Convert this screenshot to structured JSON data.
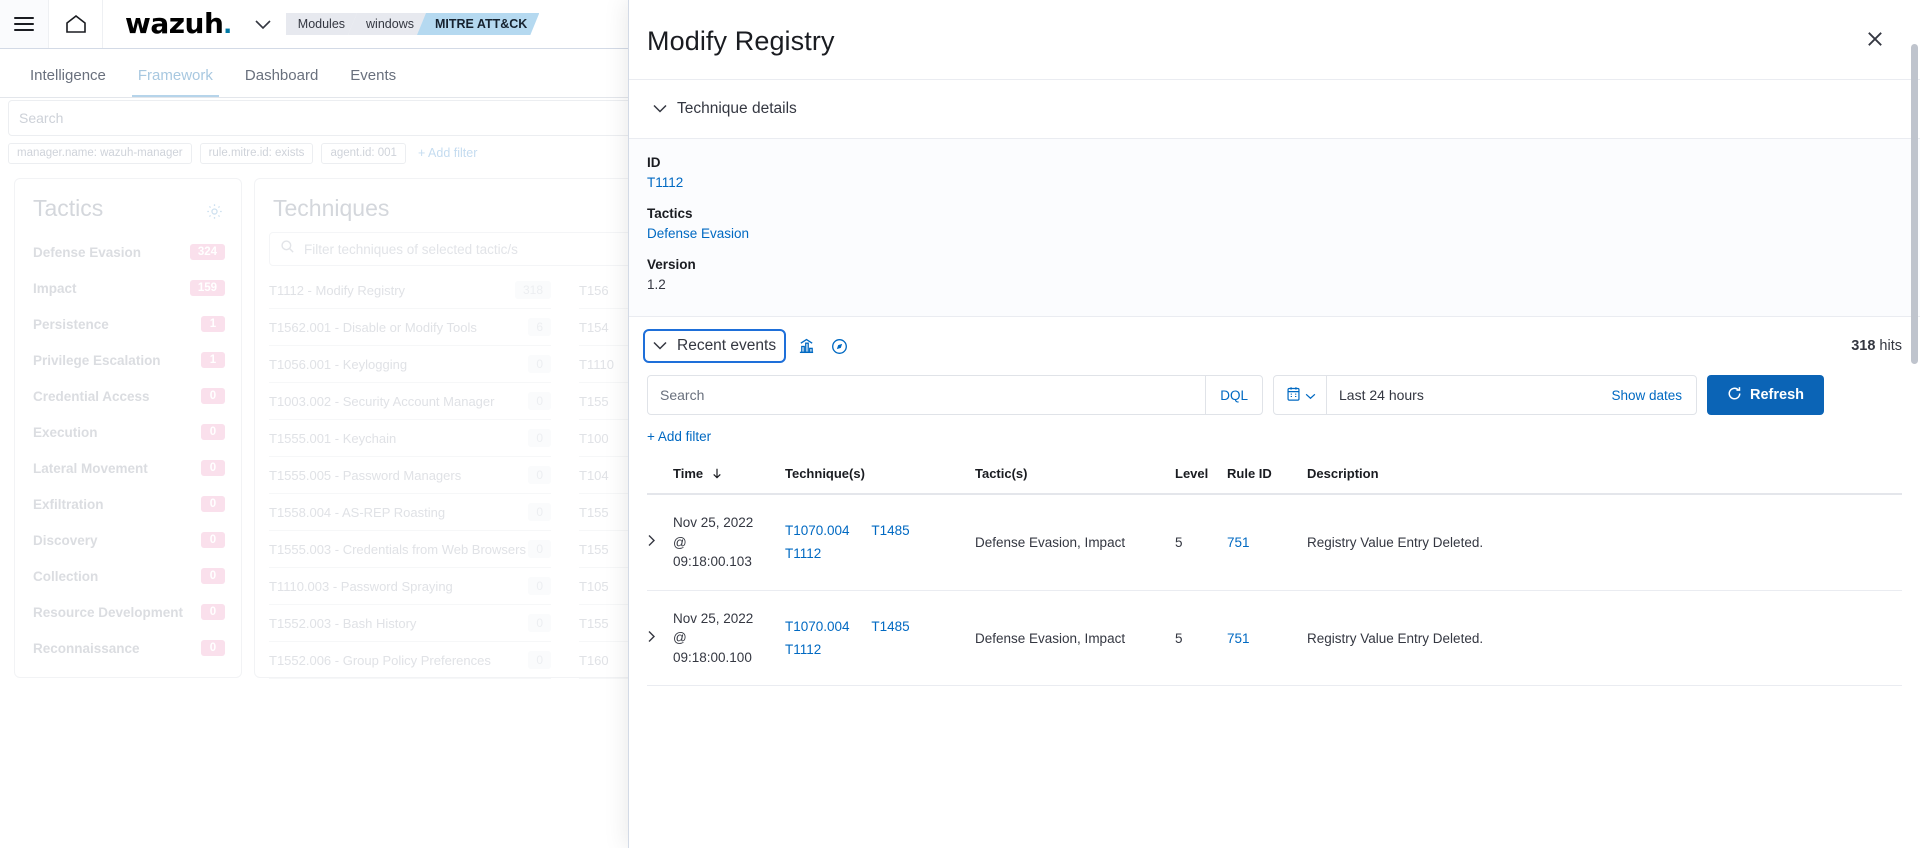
{
  "topbar": {
    "menu_icon": "hamburger-icon",
    "home_icon": "home-icon",
    "brand": "wazuh",
    "brand_dot": ".",
    "chevron_icon": "chevron-down-icon",
    "breadcrumbs": [
      {
        "label": "Modules",
        "active": false
      },
      {
        "label": "windows",
        "active": false
      },
      {
        "label": "MITRE ATT&CK",
        "active": true
      }
    ]
  },
  "tabs": [
    {
      "label": "Intelligence",
      "active": false
    },
    {
      "label": "Framework",
      "active": true
    },
    {
      "label": "Dashboard",
      "active": false
    },
    {
      "label": "Events",
      "active": false
    }
  ],
  "search": {
    "placeholder": "Search",
    "filters": [
      "manager.name: wazuh-manager",
      "rule.mitre.id: exists",
      "agent.id: 001"
    ],
    "add_filter": "+ Add filter"
  },
  "tactics_panel": {
    "title": "Tactics",
    "gear_icon": "gear-icon",
    "items": [
      {
        "label": "Defense Evasion",
        "count": "324"
      },
      {
        "label": "Impact",
        "count": "159"
      },
      {
        "label": "Persistence",
        "count": "1"
      },
      {
        "label": "Privilege Escalation",
        "count": "1"
      },
      {
        "label": "Credential Access",
        "count": "0"
      },
      {
        "label": "Execution",
        "count": "0"
      },
      {
        "label": "Lateral Movement",
        "count": "0"
      },
      {
        "label": "Exfiltration",
        "count": "0"
      },
      {
        "label": "Discovery",
        "count": "0"
      },
      {
        "label": "Collection",
        "count": "0"
      },
      {
        "label": "Resource Development",
        "count": "0"
      },
      {
        "label": "Reconnaissance",
        "count": "0"
      }
    ]
  },
  "techniques_panel": {
    "title": "Techniques",
    "filter_placeholder": "Filter techniques of selected tactic/s",
    "search_icon": "search-icon",
    "items": [
      {
        "label": "T1112 - Modify Registry",
        "count": "318"
      },
      {
        "label": "T1562.001 - Disable or Modify Tools",
        "count": "6"
      },
      {
        "label": "T1056.001 - Keylogging",
        "count": "0"
      },
      {
        "label": "T1003.002 - Security Account Manager",
        "count": "0"
      },
      {
        "label": "T1555.001 - Keychain",
        "count": "0"
      },
      {
        "label": "T1555.005 - Password Managers",
        "count": "0"
      },
      {
        "label": "T1558.004 - AS-REP Roasting",
        "count": "0"
      },
      {
        "label": "T1555.003 - Credentials from Web Browsers",
        "count": "0"
      },
      {
        "label": "T1110.003 - Password Spraying",
        "count": "0"
      },
      {
        "label": "T1552.003 - Bash History",
        "count": "0"
      },
      {
        "label": "T1552.006 - Group Policy Preferences",
        "count": "0"
      }
    ],
    "items_col2": [
      {
        "label": "T156",
        "count": ""
      },
      {
        "label": "T154",
        "count": ""
      },
      {
        "label": "T1110",
        "count": ""
      },
      {
        "label": "T155",
        "count": ""
      },
      {
        "label": "T100",
        "count": ""
      },
      {
        "label": "T104",
        "count": ""
      },
      {
        "label": "T155",
        "count": ""
      },
      {
        "label": "T155",
        "count": ""
      },
      {
        "label": "T105",
        "count": ""
      },
      {
        "label": "T155",
        "count": ""
      },
      {
        "label": "T160",
        "count": ""
      }
    ]
  },
  "flyout": {
    "title": "Modify Registry",
    "close_icon": "close-icon",
    "details_accordion": {
      "label": "Technique details",
      "chevron_icon": "chevron-down-icon",
      "fields": [
        {
          "label": "ID",
          "value": "T1112",
          "is_link": true
        },
        {
          "label": "Tactics",
          "value": "Defense Evasion",
          "is_link": true
        },
        {
          "label": "Version",
          "value": "1.2",
          "is_link": false
        }
      ]
    },
    "events_accordion": {
      "label": "Recent events",
      "chevron_icon": "chevron-down-icon",
      "focused": true,
      "visualize_icon": "bar-chart-icon",
      "discover_icon": "compass-icon",
      "hits_count": "318",
      "hits_label": "hits"
    },
    "query": {
      "search_placeholder": "Search",
      "search_value": "",
      "dql_label": "DQL",
      "calendar_icon": "calendar-icon",
      "chevron_icon": "chevron-down-icon",
      "time_range": "Last 24 hours",
      "show_dates": "Show dates",
      "refresh_icon": "refresh-icon",
      "refresh_label": "Refresh",
      "add_filter": "+ Add filter"
    },
    "table": {
      "columns": [
        "Time",
        "Technique(s)",
        "Tactic(s)",
        "Level",
        "Rule ID",
        "Description"
      ],
      "sort_icon": "arrow-down-icon",
      "expand_icon": "chevron-right-icon",
      "rows": [
        {
          "time_line1": "Nov 25, 2022",
          "time_line2": "@",
          "time_line3": "09:18:00.103",
          "techniques": [
            "T1070.004",
            "T1485",
            "T1112"
          ],
          "tactics": "Defense Evasion, Impact",
          "level": "5",
          "rule_id": "751",
          "description": "Registry Value Entry Deleted."
        },
        {
          "time_line1": "Nov 25, 2022",
          "time_line2": "@",
          "time_line3": "09:18:00.100",
          "techniques": [
            "T1070.004",
            "T1485",
            "T1112"
          ],
          "tactics": "Defense Evasion, Impact",
          "level": "5",
          "rule_id": "751",
          "description": "Registry Value Entry Deleted."
        }
      ]
    }
  },
  "colors": {
    "accent_blue": "#0069c2",
    "primary_button": "#0b64b6",
    "focus_outline": "#1e6fd9",
    "breadcrumb_active": "#b5d9f0",
    "badge_pink": "#fae0ec"
  }
}
